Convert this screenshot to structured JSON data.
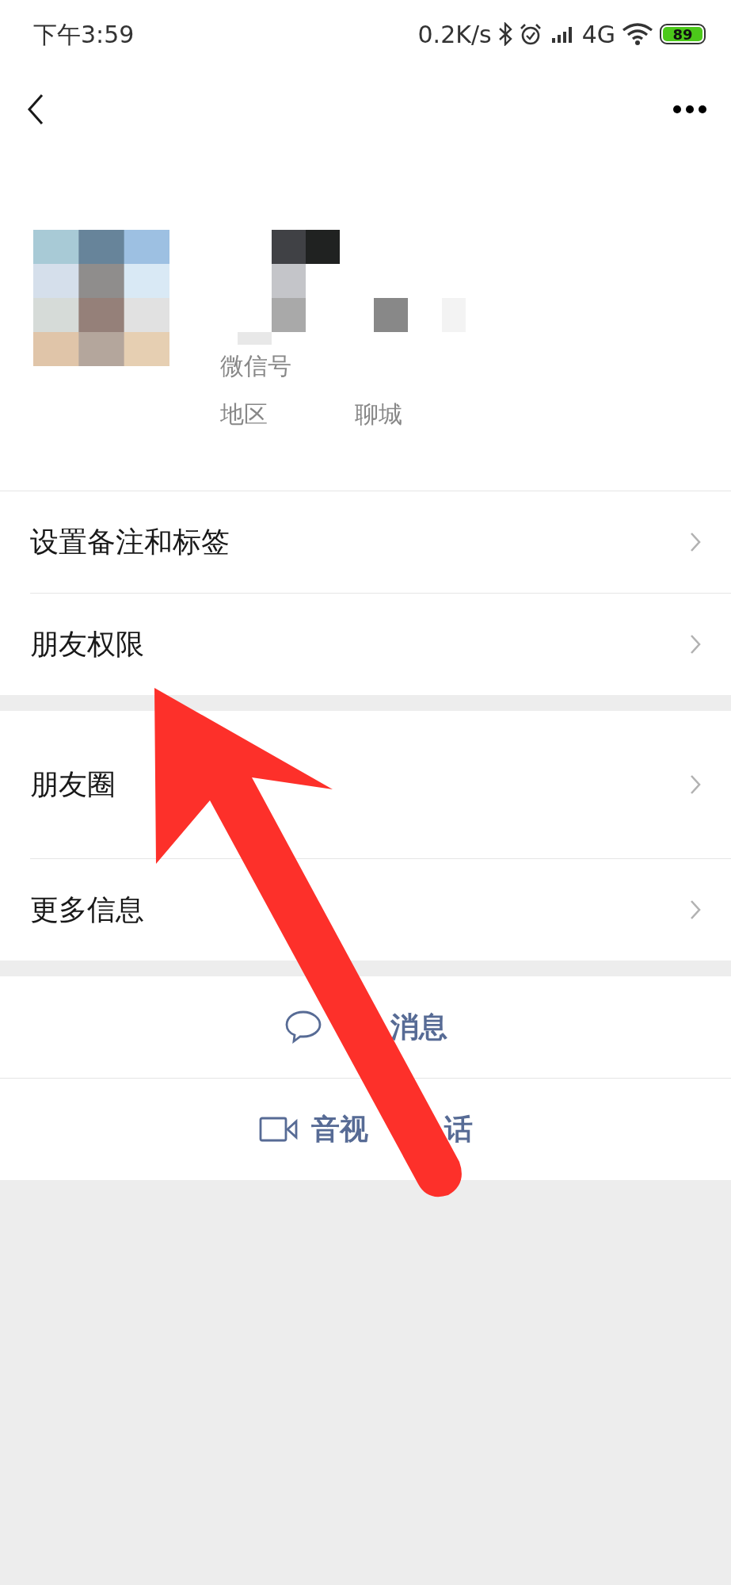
{
  "status_bar": {
    "time": "下午3:59",
    "network_speed": "0.2K/s",
    "network_type": "4G",
    "battery": "89"
  },
  "profile": {
    "wechat_id_label": "微信号",
    "region_label": "地区",
    "region_city": "聊城"
  },
  "menu_groups": [
    {
      "items": [
        {
          "label": "设置备注和标签"
        },
        {
          "label": "朋友权限"
        }
      ]
    },
    {
      "items": [
        {
          "label": "朋友圈"
        },
        {
          "label": "更多信息"
        }
      ]
    }
  ],
  "actions": [
    {
      "kind": "message",
      "label": "消息"
    },
    {
      "kind": "video",
      "label_parts": [
        "音视",
        "话"
      ]
    }
  ]
}
